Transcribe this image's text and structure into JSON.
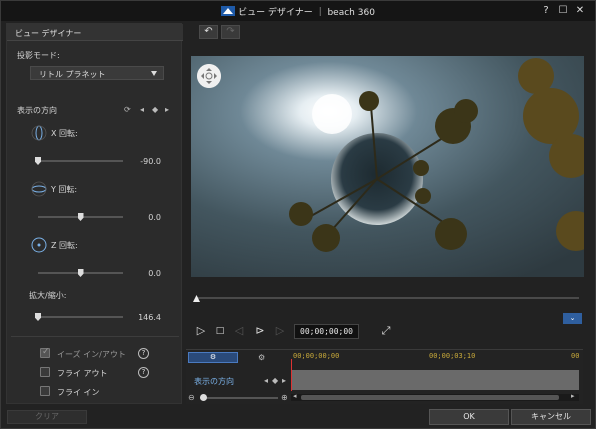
{
  "window": {
    "title": "ビュー デザイナー ｜ beach 360",
    "help_label": "?",
    "maximize_label": "☐",
    "close_label": "✕"
  },
  "left_panel": {
    "tab_label": "ビュー デザイナー",
    "projection_mode_label": "投影モード:",
    "projection_mode_value": "リトル プラネット",
    "view_direction_label": "表示の方向",
    "x_rotation_label": "X 回転:",
    "x_rotation_value": "-90.0",
    "x_rotation_fraction": 0.0,
    "y_rotation_label": "Y 回転:",
    "y_rotation_value": "0.0",
    "y_rotation_fraction": 0.5,
    "z_rotation_label": "Z 回転:",
    "z_rotation_value": "0.0",
    "z_rotation_fraction": 0.5,
    "zoom_label": "拡大/縮小:",
    "zoom_value": "146.4",
    "zoom_fraction": 0.0,
    "ease_in_out_label": "イーズ イン/アウト",
    "ease_in_out_checked": true,
    "fly_out_label": "フライ アウト",
    "fly_out_checked": false,
    "fly_in_label": "フライ イン",
    "fly_in_checked": false,
    "help_label": "?",
    "clear_label": "クリア"
  },
  "toolbar": {
    "undo_label": "↶",
    "redo_label": "↷"
  },
  "playback": {
    "timecode": "00;00;00;00",
    "progress": 0.0,
    "play_icon": "▷",
    "stop_icon": "□",
    "prev_key_icon": "◁",
    "next_frame_icon": "⊳",
    "next_key_icon": "▷",
    "fullscreen_icon": "⤢"
  },
  "timeline": {
    "ruler_labels": [
      "00;00;00;00",
      "00;00;03;10",
      "00"
    ],
    "track_label": "表示の方向"
  },
  "footer": {
    "ok_label": "OK",
    "cancel_label": "キャンセル"
  },
  "colors": {
    "accent": "#2f5f9f",
    "ruler_text": "#c8a93a",
    "playhead": "#dd3333",
    "track_label": "#7ab0e6"
  }
}
